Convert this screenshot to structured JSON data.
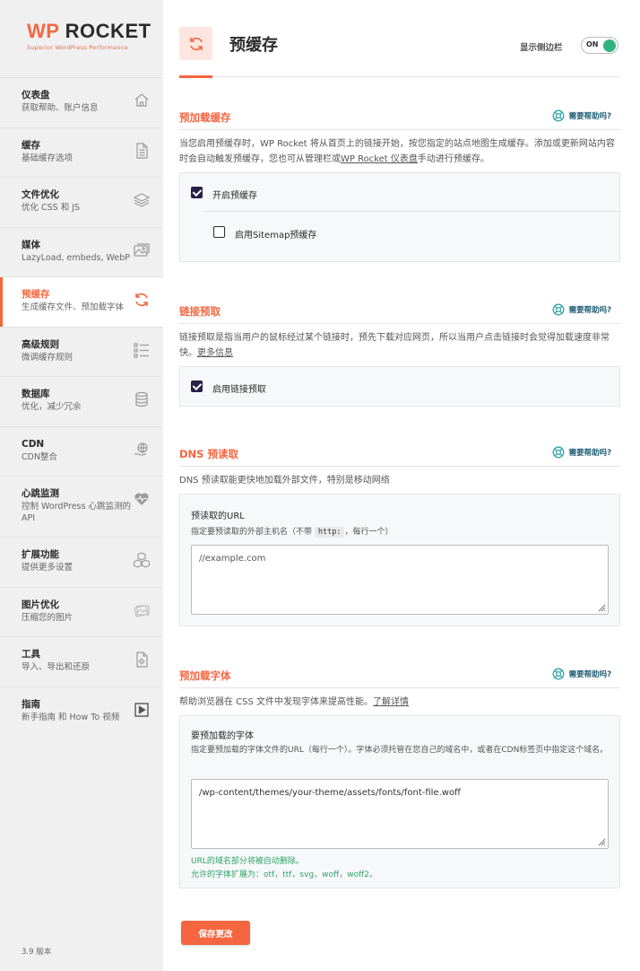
{
  "brand": {
    "name_prefix": "WP",
    "name_suffix": "ROCKET",
    "tagline": "Superior WordPress Performance"
  },
  "sidebar": {
    "items": [
      {
        "title": "仪表盘",
        "sub": "获取帮助、账户信息",
        "icon": "home-icon"
      },
      {
        "title": "缓存",
        "sub": "基础缓存选项",
        "icon": "file-icon"
      },
      {
        "title": "文件优化",
        "sub": "优化 CSS 和 JS",
        "icon": "layers-icon"
      },
      {
        "title": "媒体",
        "sub": "LazyLoad, embeds, WebP",
        "icon": "image-icon"
      },
      {
        "title": "预缓存",
        "sub": "生成缓存文件、预加载字体",
        "icon": "refresh-icon"
      },
      {
        "title": "高级规则",
        "sub": "微调缓存规则",
        "icon": "list-icon"
      },
      {
        "title": "数据库",
        "sub": "优化，减少冗余",
        "icon": "database-icon"
      },
      {
        "title": "CDN",
        "sub": "CDN整合",
        "icon": "cdn-icon"
      },
      {
        "title": "心跳监测",
        "sub": "控制 WordPress 心跳监测的 API",
        "icon": "heartbeat-icon"
      },
      {
        "title": "扩展功能",
        "sub": "提供更多设置",
        "icon": "cubes-icon"
      },
      {
        "title": "图片优化",
        "sub": "压缩您的图片",
        "icon": "photos-icon"
      },
      {
        "title": "工具",
        "sub": "导入、导出和还原",
        "icon": "tools-icon"
      },
      {
        "title": "指南",
        "sub": "新手指南 和 How To 视频",
        "icon": "play-icon"
      }
    ],
    "version": "3.9 版本"
  },
  "header": {
    "title": "预缓存",
    "sidebar_toggle_label": "显示侧边栏",
    "toggle_state": "ON"
  },
  "help_label": "需要帮助吗?",
  "sections": {
    "preload": {
      "title": "预加载缓存",
      "desc_prefix": "当您启用预缓存时，WP Rocket 将从首页上的链接开始，按您指定的站点地图生成缓存。添加或更新网站内容时会自动触发预缓存，您也可从管理栏或",
      "desc_link": "WP Rocket 仪表盘",
      "desc_suffix": "手动进行预缓存。",
      "option_main": {
        "label": "开启预缓存",
        "checked": true
      },
      "option_sitemap": {
        "label": "启用Sitemap预缓存",
        "checked": false
      }
    },
    "link_preload": {
      "title": "链接预取",
      "desc": "链接预取是指当用户的鼠标经过某个链接时，预先下载对应网页，所以当用户点击链接时会觉得加载速度非常快。",
      "desc_link": "更多信息",
      "option": {
        "label": "启用链接预取",
        "checked": true
      }
    },
    "dns": {
      "title": "DNS 预读取",
      "desc": "DNS 预读取能更快地加载外部文件，特别是移动网络",
      "field_label": "预读取的URL",
      "field_help_prefix": "指定要预读取的外部主机名（不带 ",
      "field_help_code": "http:",
      "field_help_suffix": "，每行一个）",
      "placeholder": "//example.com"
    },
    "fonts": {
      "title": "预加载字体",
      "desc": "帮助浏览器在 CSS 文件中发现字体来提高性能。",
      "desc_link": "了解详情",
      "field_label": "要预加载的字体",
      "field_help": "指定要预加载的字体文件的URL（每行一个）。字体必须托管在您自己的域名中，或者在CDN标签页中指定这个域名。",
      "placeholder": "/wp-content/themes/your-theme/assets/fonts/font-file.woff",
      "note_1": "URL的域名部分将被自动删除。",
      "note_2": "允许的字体扩展为：otf，ttf，svg，woff，woff2。"
    }
  },
  "save_label": "保存更改",
  "colors": {
    "accent": "#f56640",
    "success": "#2fb47c",
    "help": "#1f5d75",
    "checkbox": "#2b1f46"
  }
}
